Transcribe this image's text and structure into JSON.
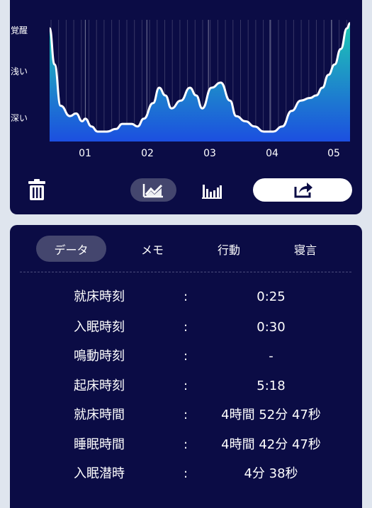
{
  "colors": {
    "card_bg": "#0b0c45",
    "page_bg": "#dfe5ee",
    "active_pill": "#44466e",
    "chart_top": "#1fc9b4",
    "chart_bottom": "#1c4fe0"
  },
  "chart": {
    "y_labels": [
      "覚醒",
      "浅い",
      "深い"
    ],
    "x_labels": [
      "01",
      "02",
      "03",
      "04",
      "05"
    ]
  },
  "chart_data": {
    "type": "area",
    "y_categories": [
      "深い",
      "浅い",
      "覚醒"
    ],
    "x_ticks": [
      "01",
      "02",
      "03",
      "04",
      "05"
    ],
    "x": [
      0.42,
      0.5,
      0.6,
      0.75,
      0.85,
      0.95,
      1.0,
      1.1,
      1.2,
      1.35,
      1.5,
      1.6,
      1.75,
      1.85,
      1.95,
      2.1,
      2.2,
      2.3,
      2.4,
      2.55,
      2.7,
      2.8,
      2.9,
      3.05,
      3.2,
      3.35,
      3.45,
      3.6,
      3.75,
      3.9,
      4.05,
      4.2,
      4.35,
      4.5,
      4.65,
      4.75,
      4.85,
      4.95,
      5.05,
      5.15,
      5.25,
      5.3
    ],
    "y": [
      2.0,
      1.3,
      0.5,
      0.3,
      0.35,
      0.2,
      0.25,
      0.1,
      0.0,
      0.0,
      0.05,
      0.15,
      0.15,
      0.1,
      0.25,
      0.55,
      0.85,
      0.7,
      0.45,
      0.6,
      0.85,
      0.7,
      0.45,
      0.85,
      0.95,
      0.6,
      0.3,
      0.2,
      0.1,
      0.0,
      0.0,
      0.1,
      0.4,
      0.6,
      0.65,
      0.7,
      0.85,
      1.1,
      1.3,
      1.6,
      2.0,
      2.1
    ],
    "ylim": [
      0,
      2
    ],
    "grid": true
  },
  "toolbar": {
    "delete_icon": "trash-icon",
    "line_chart_icon": "line-chart-icon",
    "bar_chart_icon": "bar-chart-icon",
    "share_icon": "share-icon"
  },
  "tabs": [
    {
      "label": "データ",
      "active": true
    },
    {
      "label": "メモ",
      "active": false
    },
    {
      "label": "行動",
      "active": false
    },
    {
      "label": "寝言",
      "active": false
    }
  ],
  "rows": [
    {
      "label": "就床時刻",
      "colon": ":",
      "value": "0:25"
    },
    {
      "label": "入眠時刻",
      "colon": ":",
      "value": "0:30"
    },
    {
      "label": "鳴動時刻",
      "colon": ":",
      "value": "-"
    },
    {
      "label": "起床時刻",
      "colon": ":",
      "value": "5:18"
    },
    {
      "label": "就床時間",
      "colon": ":",
      "value": "4時間 52分 47秒"
    },
    {
      "label": "睡眠時間",
      "colon": ":",
      "value": "4時間 42分 47秒"
    },
    {
      "label": "入眠潜時",
      "colon": ":",
      "value": "4分 38秒"
    }
  ]
}
